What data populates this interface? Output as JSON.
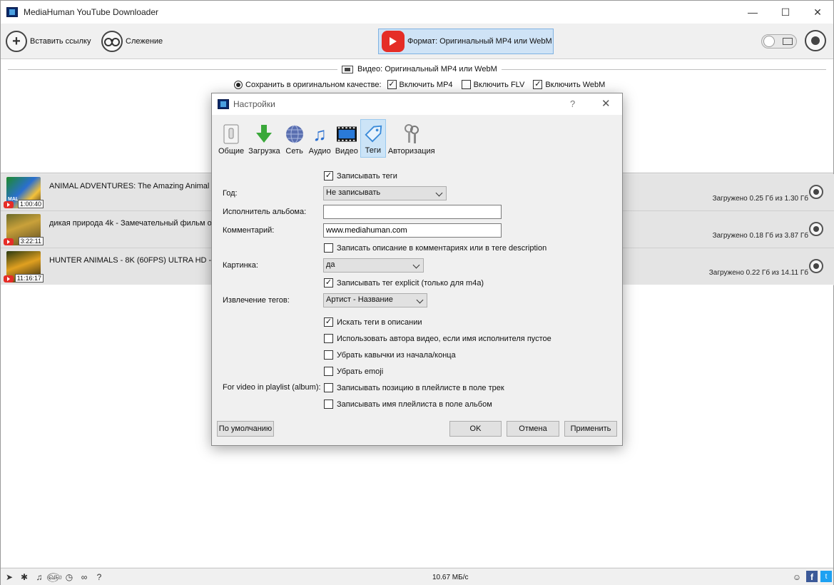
{
  "window": {
    "title": "MediaHuman YouTube Downloader"
  },
  "toolbar": {
    "paste_label": "Вставить ссылку",
    "tracking_label": "Слежение",
    "format_label": "Формат: Оригинальный MP4 или WebM"
  },
  "info_panel": {
    "title": "Видео: Оригинальный MP4 или WebM",
    "save_original": "Сохранить в оригинальном качестве:",
    "include_mp4": "Включить MP4",
    "include_flv": "Включить FLV",
    "include_webm": "Включить WebM"
  },
  "downloads": [
    {
      "title": "ANIMAL ADVENTURES: The Amazing Animal Kingdom",
      "duration": "1:00:40",
      "thumb_label": "MAL",
      "status": "Загружено 0.25 Гб из 1.30 Гб"
    },
    {
      "title": "дикая природа 4k - Замечательный фильм о дикой природе",
      "duration": "3:22:11",
      "status": "Загружено 0.18 Гб из 3.87 Гб"
    },
    {
      "title": "HUNTER ANIMALS - 8K (60FPS) ULTRA HD - With Nature Sounds",
      "duration": "11:16:17",
      "status": "Загружено 0.22 Гб из 14.11 Гб"
    }
  ],
  "statusbar": {
    "speed": "10.67 МБ/с"
  },
  "dialog": {
    "title": "Настройки",
    "help": "?",
    "tabs": [
      {
        "label": "Общие",
        "icon": "switch-icon"
      },
      {
        "label": "Загрузка",
        "icon": "download-arrow-icon"
      },
      {
        "label": "Сеть",
        "icon": "globe-icon"
      },
      {
        "label": "Аудио",
        "icon": "music-note-icon"
      },
      {
        "label": "Видео",
        "icon": "film-strip-icon"
      },
      {
        "label": "Теги",
        "icon": "tag-icon"
      },
      {
        "label": "Авторизация",
        "icon": "keys-icon"
      }
    ],
    "active_tab": "Теги",
    "write_tags": "Записывать теги",
    "year_label": "Год:",
    "year_value": "Не записывать",
    "album_artist_label": "Исполнитель альбома:",
    "album_artist_value": "",
    "comment_label": "Комментарий:",
    "comment_value": "www.mediahuman.com",
    "write_desc": "Записать описание в комментариях или в теге description",
    "picture_label": "Картинка:",
    "picture_value": "да",
    "write_explicit": "Записывать тег explicit (только для m4a)",
    "extract_label": "Извлечение тегов:",
    "extract_value": "Артист - Название",
    "search_desc": "Искать теги в описании",
    "use_author": "Использовать автора видео, если имя исполнителя пустое",
    "strip_quotes": "Убрать кавычки из начала/конца",
    "strip_emoji": "Убрать emoji",
    "playlist_label": "For video in playlist (album):",
    "write_position": "Записывать позицию в плейлисте в поле трек",
    "write_playlist_name": "Записывать имя плейлиста в поле альбом",
    "defaults_btn": "По умолчанию",
    "ok_btn": "OK",
    "cancel_btn": "Отмена",
    "apply_btn": "Применить"
  },
  "colors": {
    "accent": "#cce4f7",
    "youtube_red": "#e52d27",
    "format_btn": "#cfe3f6"
  }
}
